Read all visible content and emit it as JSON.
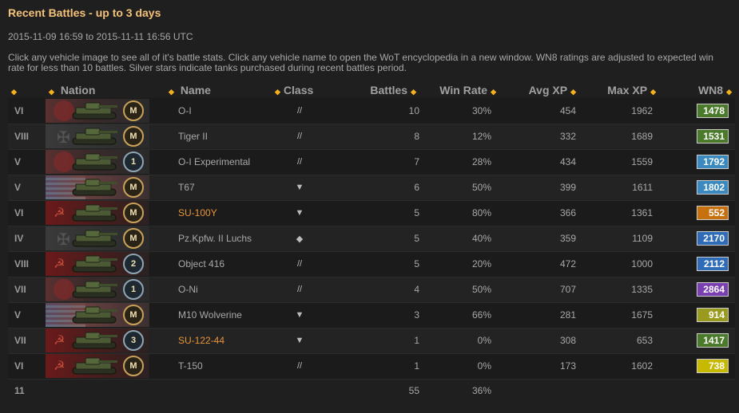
{
  "title": "Recent Battles - up to 3 days",
  "date_range": "2015-11-09 16:59 to 2015-11-11 16:56 UTC",
  "description": "Click any vehicle image to see all of it's battle stats. Click any vehicle name to open the WoT encyclopedia in a new window. WN8 ratings are adjusted to expected win rate for less than 10 battles. Silver stars indicate tanks purchased during recent battles period.",
  "columns": {
    "nation": "Nation",
    "name": "Name",
    "class": "Class",
    "battles": "Battles",
    "win_rate": "Win Rate",
    "avg_xp": "Avg XP",
    "max_xp": "Max XP",
    "wn8": "WN8"
  },
  "sort_icon": "sort-arrows-icon",
  "rows": [
    {
      "tier": "VI",
      "nation": "japan",
      "mark": "M",
      "name": "O-I",
      "premium": false,
      "class_glyph": "//",
      "class_icon": "heavy-tank-icon",
      "battles": "10",
      "win_rate": "30%",
      "avg_xp": "454",
      "max_xp": "1962",
      "wn8": "1478",
      "wn8_color": "#4a7a2a"
    },
    {
      "tier": "VIII",
      "nation": "germany",
      "mark": "M",
      "name": "Tiger II",
      "premium": false,
      "class_glyph": "//",
      "class_icon": "heavy-tank-icon",
      "battles": "8",
      "win_rate": "12%",
      "avg_xp": "332",
      "max_xp": "1689",
      "wn8": "1531",
      "wn8_color": "#4a7a2a"
    },
    {
      "tier": "V",
      "nation": "japan",
      "mark": "1",
      "name": "O-I Experimental",
      "premium": false,
      "class_glyph": "//",
      "class_icon": "heavy-tank-icon",
      "battles": "7",
      "win_rate": "28%",
      "avg_xp": "434",
      "max_xp": "1559",
      "wn8": "1792",
      "wn8_color": "#3a8ac0"
    },
    {
      "tier": "V",
      "nation": "usa",
      "mark": "M",
      "name": "T67",
      "premium": false,
      "class_glyph": "▼",
      "class_icon": "tank-destroyer-icon",
      "battles": "6",
      "win_rate": "50%",
      "avg_xp": "399",
      "max_xp": "1611",
      "wn8": "1802",
      "wn8_color": "#3a8ac0"
    },
    {
      "tier": "VI",
      "nation": "ussr",
      "mark": "M",
      "name": "SU-100Y",
      "premium": true,
      "class_glyph": "▼",
      "class_icon": "tank-destroyer-icon",
      "battles": "5",
      "win_rate": "80%",
      "avg_xp": "366",
      "max_xp": "1361",
      "wn8": "552",
      "wn8_color": "#c7700e"
    },
    {
      "tier": "IV",
      "nation": "germany",
      "mark": "M",
      "name": "Pz.Kpfw. II Luchs",
      "premium": false,
      "class_glyph": "◆",
      "class_icon": "light-tank-icon",
      "battles": "5",
      "win_rate": "40%",
      "avg_xp": "359",
      "max_xp": "1109",
      "wn8": "2170",
      "wn8_color": "#2f6cb8"
    },
    {
      "tier": "VIII",
      "nation": "ussr",
      "mark": "2",
      "name": "Object 416",
      "premium": false,
      "class_glyph": "//",
      "class_icon": "medium-tank-icon",
      "battles": "5",
      "win_rate": "20%",
      "avg_xp": "472",
      "max_xp": "1000",
      "wn8": "2112",
      "wn8_color": "#2f6cb8"
    },
    {
      "tier": "VII",
      "nation": "japan",
      "mark": "1",
      "name": "O-Ni",
      "premium": false,
      "class_glyph": "//",
      "class_icon": "heavy-tank-icon",
      "battles": "4",
      "win_rate": "50%",
      "avg_xp": "707",
      "max_xp": "1335",
      "wn8": "2864",
      "wn8_color": "#7a3fb0"
    },
    {
      "tier": "V",
      "nation": "usa",
      "mark": "M",
      "name": "M10 Wolverine",
      "premium": false,
      "class_glyph": "▼",
      "class_icon": "tank-destroyer-icon",
      "battles": "3",
      "win_rate": "66%",
      "avg_xp": "281",
      "max_xp": "1675",
      "wn8": "914",
      "wn8_color": "#9a9a1e"
    },
    {
      "tier": "VII",
      "nation": "ussr",
      "mark": "3",
      "name": "SU-122-44",
      "premium": true,
      "class_glyph": "▼",
      "class_icon": "tank-destroyer-icon",
      "battles": "1",
      "win_rate": "0%",
      "avg_xp": "308",
      "max_xp": "653",
      "wn8": "1417",
      "wn8_color": "#4a7a2a"
    },
    {
      "tier": "VI",
      "nation": "ussr",
      "mark": "M",
      "name": "T-150",
      "premium": false,
      "class_glyph": "//",
      "class_icon": "heavy-tank-icon",
      "battles": "1",
      "win_rate": "0%",
      "avg_xp": "173",
      "max_xp": "1602",
      "wn8": "738",
      "wn8_color": "#c7b800"
    }
  ],
  "totals": {
    "count": "11",
    "battles": "55",
    "win_rate": "36%"
  }
}
